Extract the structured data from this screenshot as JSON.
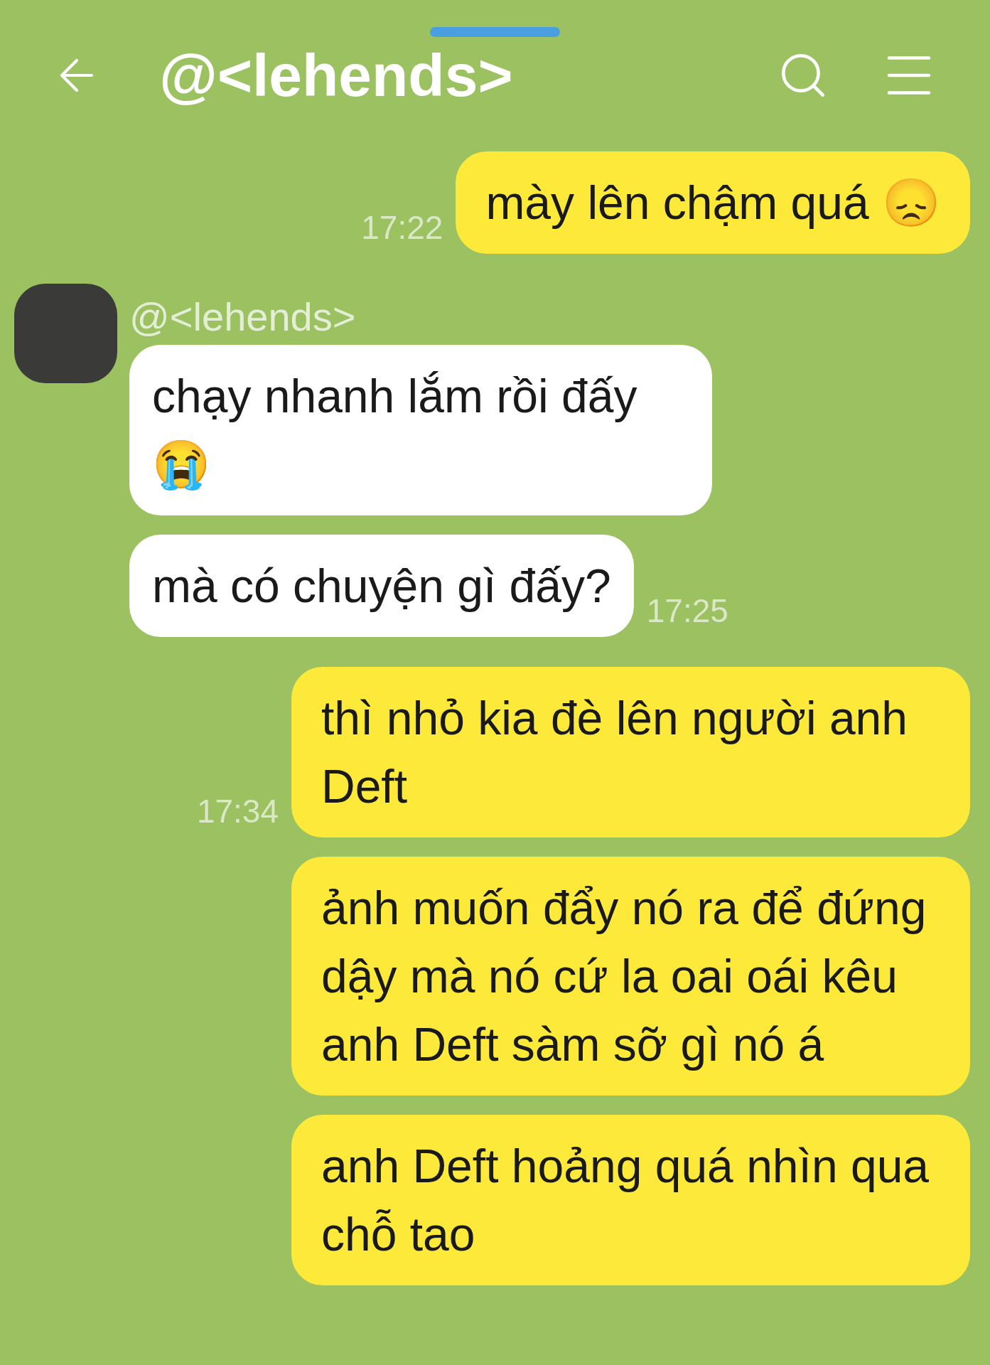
{
  "header": {
    "title": "@<lehends>"
  },
  "messages": [
    {
      "kind": "outgoing",
      "text": "mày lên chậm quá 😞",
      "time": "17:22"
    },
    {
      "kind": "incoming",
      "sender": "@<lehends>",
      "text": "chạy nhanh lắm rồi đấy 😭"
    },
    {
      "kind": "incoming",
      "text": "mà có chuyện gì đấy?",
      "time": "17:25"
    },
    {
      "kind": "outgoing",
      "text": "thì nhỏ kia đè lên người anh Deft",
      "time": "17:34"
    },
    {
      "kind": "outgoing",
      "text": "ảnh muốn đẩy nó ra để đứng dậy mà nó cứ la oai oái kêu anh Deft sàm sỡ gì nó á"
    },
    {
      "kind": "outgoing",
      "text": "anh Deft hoảng quá nhìn qua chỗ tao"
    }
  ]
}
